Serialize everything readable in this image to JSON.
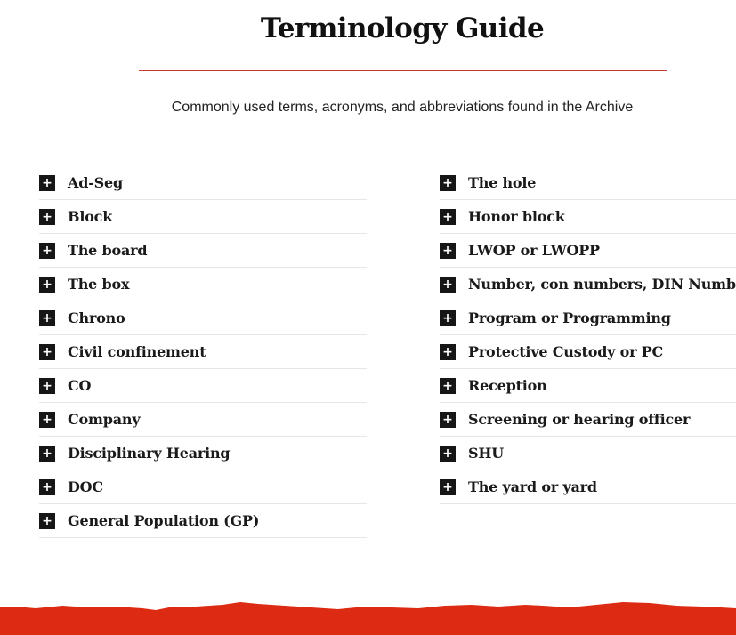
{
  "header": {
    "title": "Terminology Guide",
    "subtitle": "Commonly used terms, acronyms, and abbreviations found in the Archive"
  },
  "colors": {
    "accent": "#c0392b",
    "footer": "#dd2a12",
    "icon_bg": "#161616"
  },
  "expand_icon": {
    "name": "plus-icon",
    "glyph": "+"
  },
  "terms_left": [
    "Ad-Seg",
    "Block",
    "The board",
    "The box",
    "Chrono",
    "Civil confinement",
    "CO",
    "Company",
    "Disciplinary Hearing",
    "DOC",
    "General Population (GP)"
  ],
  "terms_right": [
    "The hole",
    "Honor block",
    "LWOP or LWOPP",
    "Number, con numbers, DIN Number",
    "Program or Programming",
    "Protective Custody or PC",
    "Reception",
    "Screening or hearing officer",
    "SHU",
    "The yard or yard"
  ]
}
